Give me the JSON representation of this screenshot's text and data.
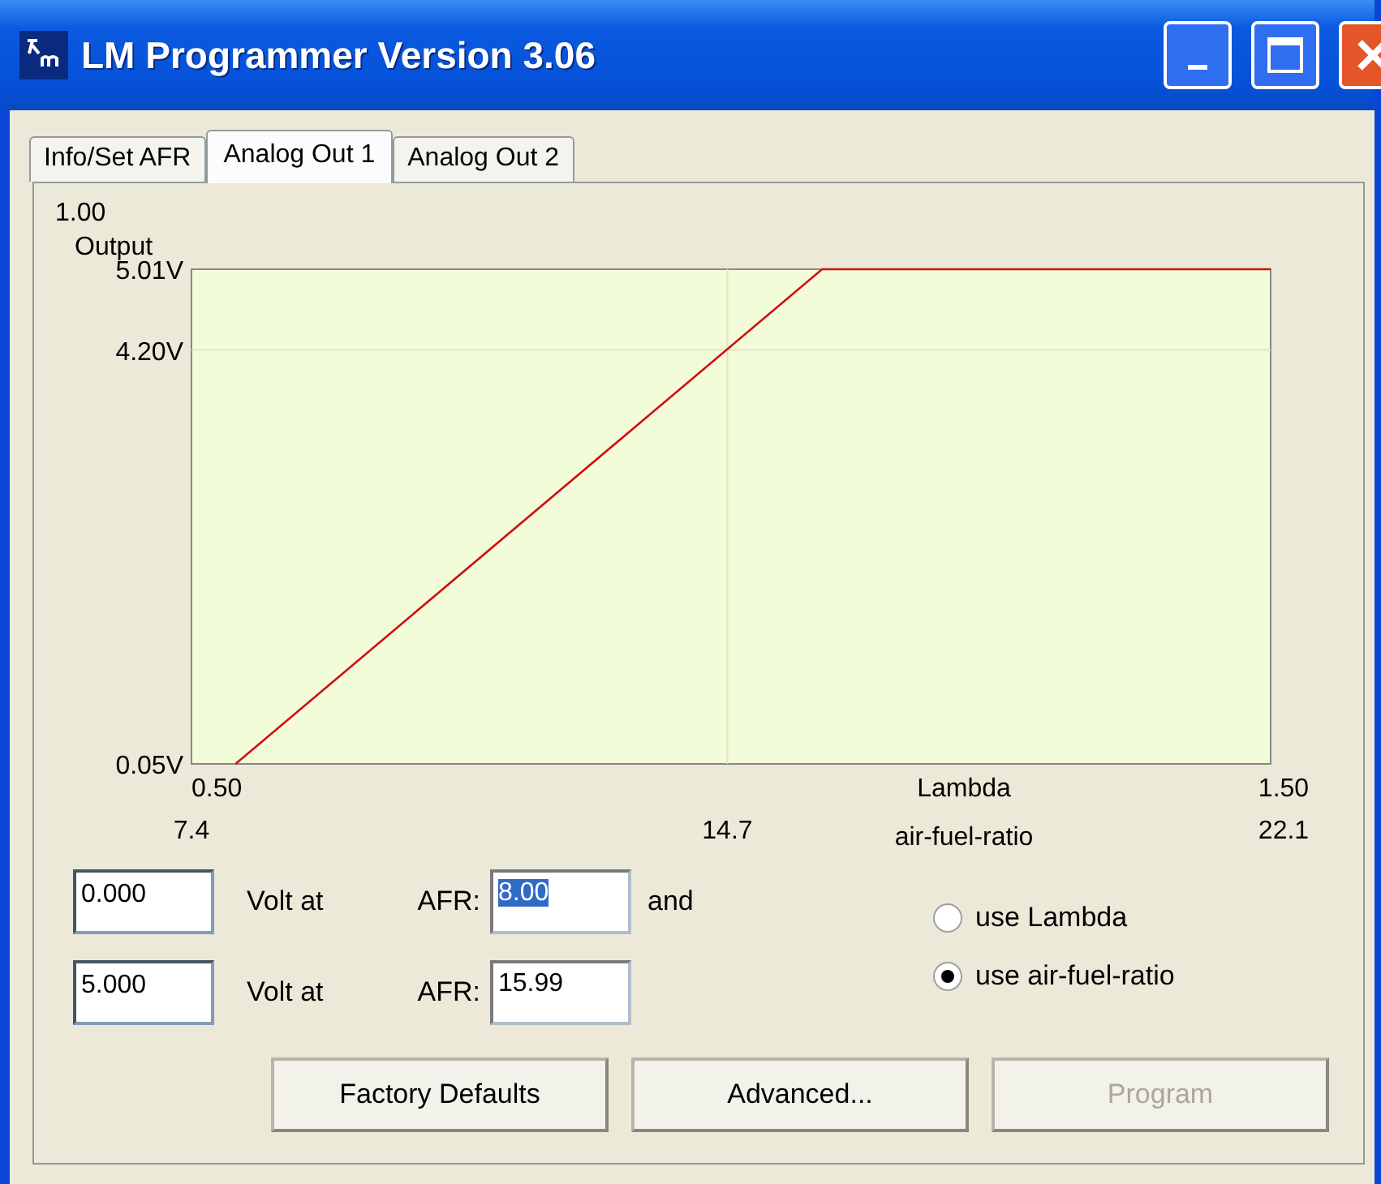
{
  "window": {
    "title": "LM Programmer Version 3.06"
  },
  "tabs": [
    {
      "label": "Info/Set AFR",
      "selected": false
    },
    {
      "label": "Analog Out 1",
      "selected": true
    },
    {
      "label": "Analog Out 2",
      "selected": false
    }
  ],
  "chart": {
    "corner_label": "1.00",
    "lambda_ticks": [
      "0.50",
      "1.50"
    ],
    "lambda_label": "Lambda",
    "chart_data": {
      "type": "line",
      "ylabel": "Output",
      "xlabel": "air-fuel-ratio",
      "x": [
        8.0,
        15.99,
        22.1
      ],
      "series": [
        {
          "color": "#d01010",
          "values": [
            0.05,
            5.01,
            5.01
          ]
        }
      ],
      "xlim": [
        7.4,
        22.1
      ],
      "ylim": [
        0.05,
        5.01
      ],
      "xticks": [
        7.4,
        14.7,
        22.1
      ],
      "yticks": [
        {
          "value": 0.05,
          "label": "0.05V"
        },
        {
          "value": 4.2,
          "label": "4.20V"
        },
        {
          "value": 5.01,
          "label": "5.01V"
        }
      ]
    }
  },
  "points": [
    {
      "volt": "0.000",
      "volt_label": "Volt at",
      "afr_label": "AFR:",
      "afr": "8.00",
      "afr_selected": true,
      "suffix": "and"
    },
    {
      "volt": "5.000",
      "volt_label": "Volt at",
      "afr_label": "AFR:",
      "afr": "15.99",
      "afr_selected": false
    }
  ],
  "modes": [
    {
      "label": "use Lambda",
      "selected": false
    },
    {
      "label": "use air-fuel-ratio",
      "selected": true
    }
  ],
  "buttons": [
    {
      "label": "Factory Defaults",
      "disabled": false
    },
    {
      "label": "Advanced...",
      "disabled": false
    },
    {
      "label": "Program",
      "disabled": true
    }
  ]
}
